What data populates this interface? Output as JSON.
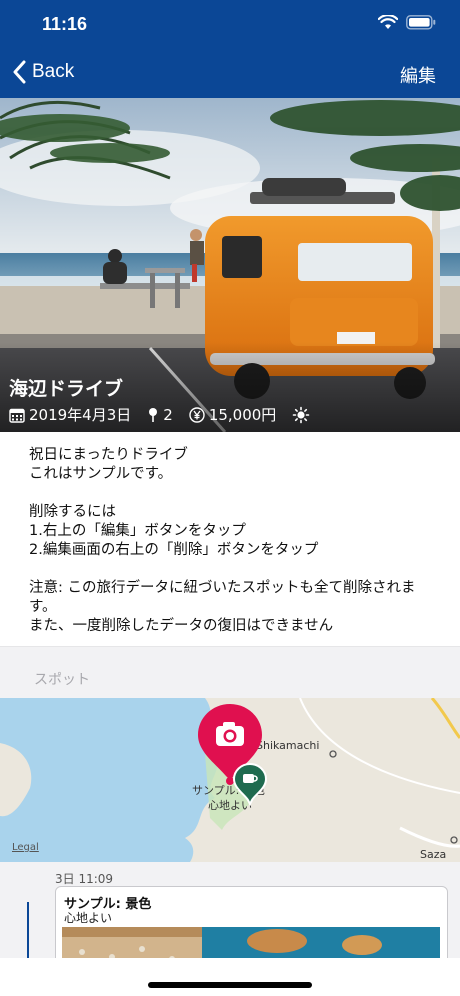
{
  "status_bar": {
    "time": "11:16"
  },
  "nav": {
    "back_label": "Back",
    "edit_label": "編集"
  },
  "trip": {
    "title": "海辺ドライブ",
    "date": "2019年4月3日",
    "spot_count": "2",
    "cost": "15,000円",
    "weather_icon": "sun-icon"
  },
  "description": {
    "para1": "祝日にまったりドライブ\nこれはサンプルです。",
    "para2": "削除するには\n1.右上の「編集」ボタンをタップ\n2.編集画面の右上の「削除」ボタンをタップ",
    "para3": "注意: この旅行データに紐づいたスポットも全て削除されます。\nまた、一度削除したデータの復旧はできません"
  },
  "spots": {
    "section_label": "スポット",
    "map": {
      "legal": "Legal",
      "place_shikamachi": "Shikamachi",
      "place_saza": "Saza",
      "pin_label_line1": "サンプル: 景色",
      "pin_label_line2": "心地よい"
    },
    "timeline": [
      {
        "datetime": "3日 11:09",
        "title": "サンプル: 景色",
        "note": "心地よい"
      }
    ]
  },
  "colors": {
    "nav_bg": "#0b4796",
    "pin_red": "#e0104f",
    "pin_green": "#1f6b4f"
  }
}
